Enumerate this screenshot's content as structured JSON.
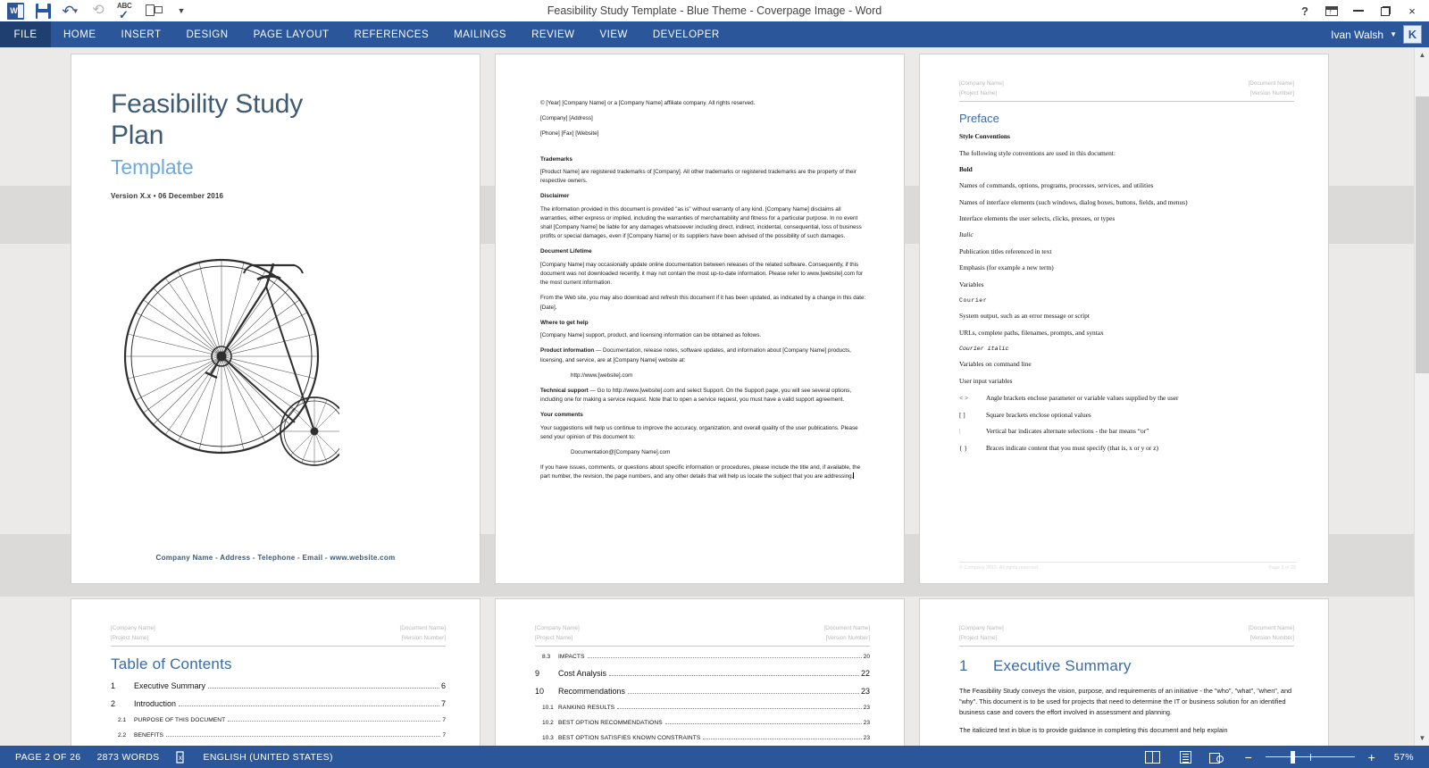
{
  "window": {
    "title": "Feasibility Study Template - Blue Theme - Coverpage Image - Word",
    "help_icon": "?",
    "ribbon_display_icon": "ribbon-display-options-icon",
    "minimize_icon": "minimize-icon",
    "restore_icon": "restore-icon",
    "close_icon": "×"
  },
  "quick_access": {
    "word_logo": "W",
    "save_label": "Save",
    "undo_label": "Undo",
    "redo_label": "Repeat",
    "spelling_label": "Spelling & Grammar",
    "touch_label": "Touch/Mouse Mode",
    "customize_label": "Customize Quick Access Toolbar",
    "abc_text": "ABC"
  },
  "ribbon": {
    "file_tab": "FILE",
    "tabs": [
      "HOME",
      "INSERT",
      "DESIGN",
      "PAGE LAYOUT",
      "REFERENCES",
      "MAILINGS",
      "REVIEW",
      "VIEW",
      "DEVELOPER"
    ]
  },
  "account": {
    "name": "Ivan Walsh",
    "badge_initial": "K"
  },
  "pages": {
    "cover": {
      "title_line1": "Feasibility Study",
      "title_line2": "Plan",
      "subtitle": "Template",
      "version": "Version X.x • 06 December 2016",
      "footer": "Company Name - Address - Telephone - Email - www.website.com",
      "image_alt": "penny-farthing-bicycle-illustration"
    },
    "legal": {
      "copyright": "© [Year] [Company Name] or a [Company Name] affiliate company. All rights reserved.",
      "company_address": "[Company] [Address]",
      "contact": "[Phone] [Fax] [Website]",
      "trademarks_heading": "Trademarks",
      "trademarks_body": "[Product Name] are registered trademarks of [Company]. All other trademarks or registered trademarks are the property of their respective owners.",
      "disclaimer_heading": "Disclaimer",
      "disclaimer_body": "The information provided in this document is provided \"as is\" without warranty of any kind. [Company Name] disclaims all warranties, either express or implied, including the warranties of merchantability and fitness for a particular purpose. In no event shall [Company Name] be liable for any damages whatsoever including direct, indirect, incidental, consequential, loss of business profits or special damages, even if [Company Name] or its suppliers have been advised of the possibility of such damages.",
      "lifetime_heading": "Document Lifetime",
      "lifetime_body1": "[Company Name] may occasionally update online documentation between releases of the related software. Consequently, if this document was not downloaded recently, it may not contain the most up-to-date information. Please refer to www.[website].com for the most current information.",
      "lifetime_body2": "From the Web site, you may also download and refresh this document if it has been updated, as indicated by a change in this date: [Date].",
      "help_heading": "Where to get help",
      "help_body": "[Company Name] support, product, and licensing information can be obtained as follows.",
      "product_info_label": "Product information",
      "product_info_body": " — Documentation, release notes, software updates, and information about [Company Name] products, licensing, and service, are at [Company Name] website at:",
      "product_url": "http://www.[website].com",
      "tech_support_label": "Technical support",
      "tech_support_body": " — Go to http://www.[website].com and select Support. On the Support page, you will see several options, including one for making a service request. Note that to open a service request, you must have a valid support agreement.",
      "comments_heading": "Your comments",
      "comments_body": "Your suggestions will help us continue to improve the accuracy, organization, and overall quality of the user publications. Please send your opinion of this document to:",
      "comments_email": "Documentation@[Company Name].com",
      "comments_tail": "If you have issues, comments, or questions about specific information or procedures, please include the title and, if available, the part number, the revision, the page numbers, and any other details that will help us locate the subject that you are addressing."
    },
    "header": {
      "left_line1": "[Company Name]",
      "left_line2": "[Project Name]",
      "right_line1": "[Document Name]",
      "right_line2": "[Version Number]"
    },
    "footer": {
      "left": "© Company 2016. All rights reserved.",
      "right": "Page 3 of 28"
    },
    "preface": {
      "heading": "Preface",
      "style_conventions_heading": "Style Conventions",
      "intro": "The following style conventions are used in this document:",
      "items": [
        {
          "style": "bold",
          "text": "Bold"
        },
        {
          "style": "normal",
          "text": "Names of commands, options, programs, processes, services, and utilities"
        },
        {
          "style": "normal",
          "text": "Names of interface elements (such windows, dialog boxes, buttons, fields, and menus)"
        },
        {
          "style": "normal",
          "text": "Interface elements the user selects, clicks, presses, or types"
        },
        {
          "style": "italic",
          "text": "Italic"
        },
        {
          "style": "normal",
          "text": "Publication titles referenced in text"
        },
        {
          "style": "normal",
          "text": "Emphasis (for example a new term)"
        },
        {
          "style": "normal",
          "text": "Variables"
        },
        {
          "style": "mono",
          "text": "Courier"
        },
        {
          "style": "normal",
          "text": "System output, such as an error message or script"
        },
        {
          "style": "normal",
          "text": "URLs, complete paths, filenames, prompts, and syntax"
        },
        {
          "style": "mono-italic",
          "text": "Courier italic"
        },
        {
          "style": "normal",
          "text": "Variables on command line"
        },
        {
          "style": "normal",
          "text": "User input variables"
        }
      ],
      "symbols": [
        {
          "sym": "< >",
          "desc": "Angle brackets enclose parameter or variable values supplied by the user"
        },
        {
          "sym": "[ ]",
          "desc": "Square brackets enclose optional values"
        },
        {
          "sym": "|",
          "desc": "Vertical bar indicates alternate selections - the bar means “or”"
        },
        {
          "sym": "{ }",
          "desc": "Braces indicate content that you must specify (that is, x or y or z)"
        }
      ]
    },
    "toc": {
      "title": "Table of Contents",
      "rows": [
        {
          "level": 1,
          "num": "1",
          "label": "Executive Summary",
          "page": "6"
        },
        {
          "level": 1,
          "num": "2",
          "label": "Introduction",
          "page": "7"
        },
        {
          "level": 2,
          "num": "2.1",
          "label": "Purpose of this document",
          "page": "7"
        },
        {
          "level": 2,
          "num": "2.2",
          "label": "Benefits",
          "page": "7"
        }
      ]
    },
    "toc2": {
      "rows": [
        {
          "level": 2,
          "num": "8.3",
          "label": "Impacts",
          "page": "20"
        },
        {
          "level": 1,
          "num": "9",
          "label": "Cost Analysis",
          "page": "22"
        },
        {
          "level": 1,
          "num": "10",
          "label": "Recommendations",
          "page": "23"
        },
        {
          "level": 2,
          "num": "10.1",
          "label": "Ranking Results",
          "page": "23"
        },
        {
          "level": 2,
          "num": "10.2",
          "label": "Best Option Recommendations",
          "page": "23"
        },
        {
          "level": 2,
          "num": "10.3",
          "label": "Best Option Satisfies Known Constraints",
          "page": "23"
        }
      ]
    },
    "exec": {
      "number": "1",
      "title": "Executive Summary",
      "para1": "The Feasibility Study conveys the vision, purpose, and requirements of an initiative - the \"who\", \"what\", \"when\", and \"why\".  This document is to be used for projects that need to determine the IT or business solution for an identified business case and covers the effort involved in assessment and planning.",
      "para2": "The italicized text in blue is to provide guidance in completing this document and help explain"
    }
  },
  "status_bar": {
    "page_info": "PAGE 2 OF 26",
    "word_count": "2873 WORDS",
    "proofing_icon": "proofing-errors-icon",
    "language": "ENGLISH (UNITED STATES)",
    "view_read_icon": "read-mode-icon",
    "view_print_icon": "print-layout-icon",
    "view_web_icon": "web-layout-icon",
    "zoom_out": "−",
    "zoom_in": "+",
    "zoom_level": "57%"
  },
  "scrollbar": {
    "up_arrow": "▲",
    "down_arrow": "▼"
  },
  "colors": {
    "word_blue": "#2b579a",
    "file_tab_blue": "#1e3f70",
    "heading_blue": "#3b6ba5",
    "cover_title": "#3f5a73",
    "cover_sub": "#6fa8dc",
    "canvas_gray": "#eceae8"
  }
}
